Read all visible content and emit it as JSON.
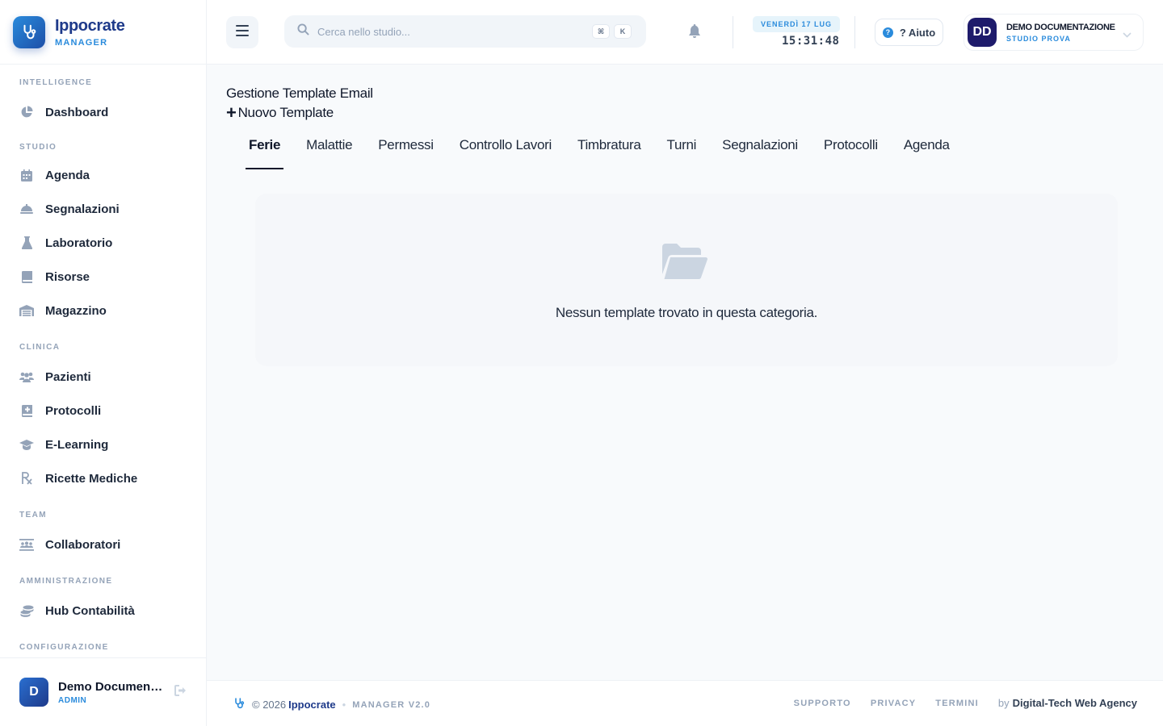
{
  "brand": {
    "name": "Ippocrate",
    "sub": "MANAGER"
  },
  "sidebar": {
    "sections": [
      {
        "title": "INTELLIGENCE",
        "items": [
          {
            "label": "Dashboard",
            "icon": "pie-chart-icon"
          }
        ]
      },
      {
        "title": "STUDIO",
        "items": [
          {
            "label": "Agenda",
            "icon": "calendar-icon"
          },
          {
            "label": "Segnalazioni",
            "icon": "bell-concierge-icon"
          },
          {
            "label": "Laboratorio",
            "icon": "flask-icon"
          },
          {
            "label": "Risorse",
            "icon": "book-icon"
          },
          {
            "label": "Magazzino",
            "icon": "warehouse-icon"
          }
        ]
      },
      {
        "title": "CLINICA",
        "items": [
          {
            "label": "Pazienti",
            "icon": "users-icon"
          },
          {
            "label": "Protocolli",
            "icon": "medical-book-icon"
          },
          {
            "label": "E-Learning",
            "icon": "graduation-cap-icon"
          },
          {
            "label": "Ricette Mediche",
            "icon": "prescription-icon"
          }
        ]
      },
      {
        "title": "TEAM",
        "items": [
          {
            "label": "Collaboratori",
            "icon": "people-roof-icon"
          }
        ]
      },
      {
        "title": "AMMINISTRAZIONE",
        "items": [
          {
            "label": "Hub Contabilità",
            "icon": "coins-icon"
          }
        ]
      },
      {
        "title": "CONFIGURAZIONE",
        "items": []
      }
    ],
    "user": {
      "initial": "D",
      "name": "Demo Documentazione",
      "role": "ADMIN"
    }
  },
  "header": {
    "search_placeholder": "Cerca nello studio...",
    "kbd_1": "⌘",
    "kbd_2": "K",
    "date": "VENERDÌ 17 LUG",
    "time": "15:31:48",
    "help_label": "? Aiuto",
    "profile": {
      "initials": "DD",
      "name": "DEMO DOCUMENTAZIONE",
      "studio": "STUDIO PROVA"
    }
  },
  "main": {
    "title": "Gestione Template Email",
    "new_template": "Nuovo Template",
    "tabs": [
      "Ferie",
      "Malattie",
      "Permessi",
      "Controllo Lavori",
      "Timbratura",
      "Turni",
      "Segnalazioni",
      "Protocolli",
      "Agenda"
    ],
    "active_tab": "Ferie",
    "empty_message": "Nessun template trovato in questa categoria."
  },
  "footer": {
    "copyright": "© 2026",
    "brand": "Ippocrate",
    "version": "MANAGER V2.0",
    "links": [
      "SUPPORTO",
      "PRIVACY",
      "TERMINI"
    ],
    "by": "by",
    "agency": "Digital-Tech Web Agency"
  },
  "colors": {
    "accent": "#2a8bdc",
    "brand_dark": "#1e3a8a",
    "profile_avatar": "#1e1b6b"
  }
}
